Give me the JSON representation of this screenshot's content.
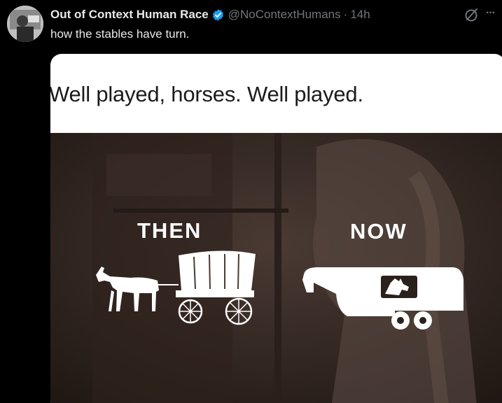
{
  "tweet": {
    "author_name": "Out of Context Human Race",
    "handle": "@NoContextHumans",
    "separator": "·",
    "time": "14h",
    "text": "how the stables have turn.",
    "more_label": "···"
  },
  "media": {
    "caption": "Well played, horses. Well played.",
    "left_label": "THEN",
    "right_label": "NOW"
  },
  "icons": {
    "verified": "verified-badge-icon",
    "grok": "grok-icon",
    "more": "more-options-icon"
  },
  "colors": {
    "background": "#000000",
    "text_primary": "#e7e9ea",
    "text_secondary": "#71767b",
    "verified_blue": "#1d9bf0",
    "meme_background": "#3a2a24"
  }
}
